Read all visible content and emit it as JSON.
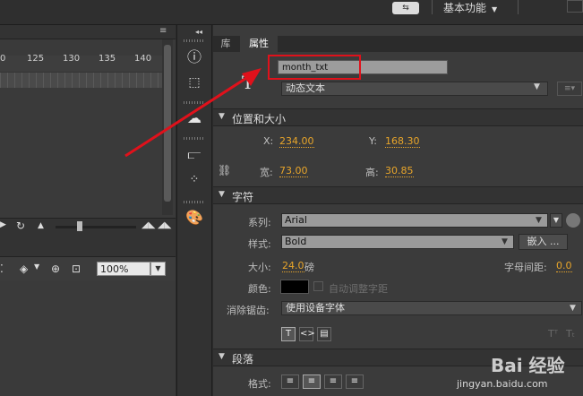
{
  "topbar": {
    "sync_label": "⇆",
    "workspace": "基本功能"
  },
  "timeline": {
    "ruler_labels": [
      "0",
      "125",
      "130",
      "135",
      "140"
    ]
  },
  "stage": {
    "zoom": "100%"
  },
  "tabs": {
    "library": "库",
    "properties": "属性"
  },
  "instance": {
    "name": "month_txt",
    "text_type": "动态文本"
  },
  "position_size": {
    "title": "位置和大小",
    "x_label": "X:",
    "x": "234.00",
    "y_label": "Y:",
    "y": "168.30",
    "w_label": "宽:",
    "w": "73.00",
    "h_label": "高:",
    "h": "30.85"
  },
  "character": {
    "title": "字符",
    "family_label": "系列:",
    "family": "Arial",
    "style_label": "样式:",
    "style": "Bold",
    "embed_label": "嵌入 ...",
    "size_label": "大小:",
    "size": "24.0",
    "size_unit": "磅",
    "spacing_label": "字母间距:",
    "spacing": "0.0",
    "color_label": "颜色:",
    "color": "#000000",
    "auto_kern_label": "自动调整字距",
    "aa_label": "消除锯齿:",
    "aa": "使用设备字体"
  },
  "paragraph": {
    "title": "段落",
    "format_label": "格式:"
  },
  "watermark": {
    "brand": "Bai 经验",
    "url": "jingyan.baidu.com"
  },
  "colors": {
    "accent_value": "#e8a52a",
    "highlight": "#e0111b",
    "panel": "#3b3b3b"
  }
}
